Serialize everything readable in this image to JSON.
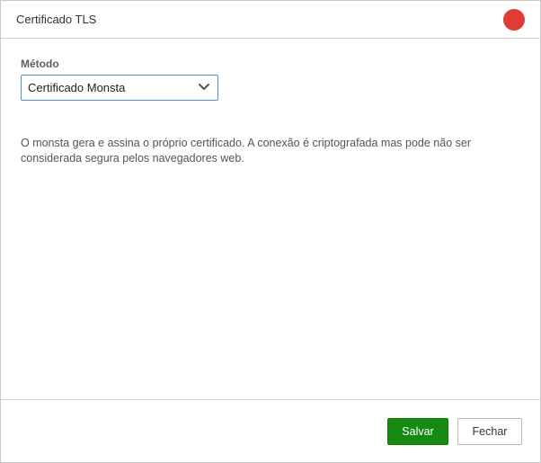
{
  "dialog": {
    "title": "Certificado TLS",
    "close_color": "#e03b34"
  },
  "form": {
    "method_label": "Método",
    "method_value": "Certificado Monsta",
    "description": "O monsta gera e assina o próprio certificado. A conexão é criptografada mas pode não ser considerada segura pelos navegadores web."
  },
  "footer": {
    "save_label": "Salvar",
    "save_color": "#148a10",
    "close_label": "Fechar"
  },
  "icons": {
    "close": "close-dot-icon",
    "dropdown": "chevron-down-icon"
  }
}
